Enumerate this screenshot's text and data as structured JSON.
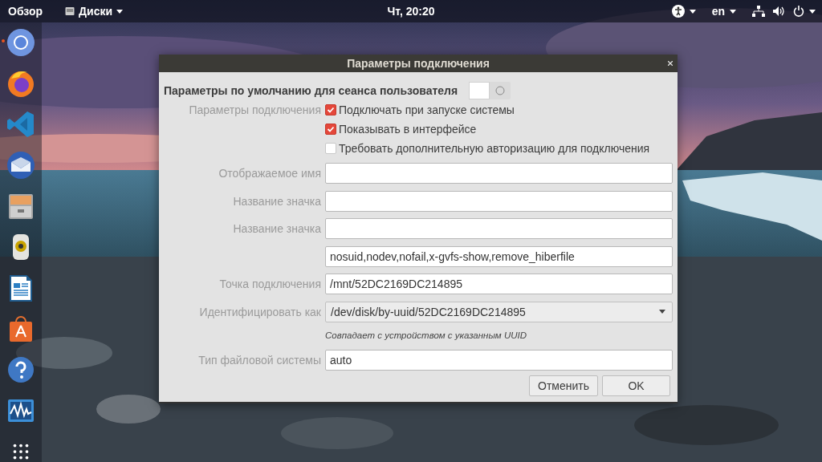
{
  "top_bar": {
    "activities": "Обзор",
    "app_menu": "Диски",
    "clock": "Чт, 20:20",
    "language": "en"
  },
  "dock": {
    "items": [
      {
        "kind": "chrome",
        "running": true
      },
      {
        "kind": "firefox",
        "running": false
      },
      {
        "kind": "vscode",
        "running": false
      },
      {
        "kind": "thunderbird",
        "running": false
      },
      {
        "kind": "cabinet",
        "running": false
      },
      {
        "kind": "speaker",
        "running": false
      },
      {
        "kind": "writer",
        "running": false
      },
      {
        "kind": "store",
        "running": false
      },
      {
        "kind": "help",
        "running": false
      },
      {
        "kind": "monitor",
        "running": false
      },
      {
        "kind": "apps",
        "running": false
      }
    ]
  },
  "dialog": {
    "title": "Параметры подключения",
    "session_defaults": {
      "label": "Параметры по умолчанию для сеанса пользователя",
      "on": false
    },
    "options_label": "Параметры подключения",
    "checkboxes": [
      {
        "label": "Подключать при запуске системы",
        "checked": true
      },
      {
        "label": "Показывать в интерфейсе",
        "checked": true
      },
      {
        "label": "Требовать дополнительную авторизацию для подключения",
        "checked": false
      }
    ],
    "fields": [
      {
        "kind": "text",
        "label": "Отображаемое имя"
      },
      {
        "kind": "text",
        "label": "Название значка"
      },
      {
        "kind": "text",
        "label": "Название значка"
      },
      {
        "kind": "text",
        "value": "nosuid,nodev,nofail,x-gvfs-show,remove_hiberfile"
      },
      {
        "kind": "text",
        "label": "Точка подключения",
        "value": "/mnt/52DC2169DC214895"
      },
      {
        "kind": "combo",
        "label": "Идентифицировать как",
        "value": "/dev/disk/by-uuid/52DC2169DC214895"
      },
      {
        "kind": "hint",
        "value": "Совпадает с устройством с указанным UUID"
      },
      {
        "kind": "text",
        "label": "Тип файловой системы",
        "value": "auto"
      }
    ],
    "buttons": [
      "Отменить",
      "OK"
    ]
  }
}
